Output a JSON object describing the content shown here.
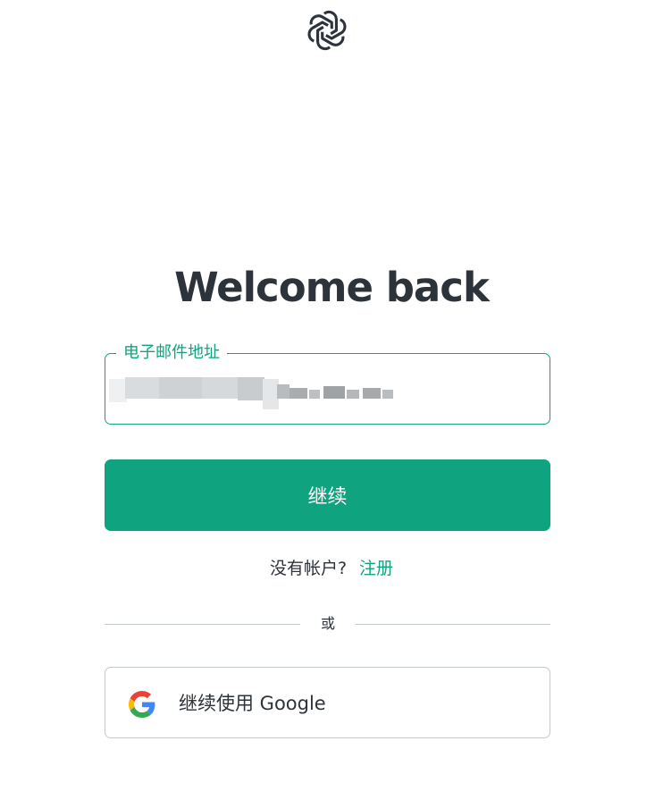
{
  "header": {
    "logo_icon": "openai-logo-icon"
  },
  "title": "Welcome back",
  "email": {
    "label": "电子邮件地址",
    "value": "",
    "value_obscured": true
  },
  "continue_button": {
    "label": "继续"
  },
  "signup": {
    "question": "没有帐户?",
    "link_label": "注册"
  },
  "divider": {
    "label": "或"
  },
  "google_button": {
    "icon": "google-icon",
    "label": "继续使用 Google"
  },
  "colors": {
    "accent": "#10a37f",
    "text": "#2d333a",
    "border": "#c2c8d0",
    "background": "#ffffff"
  }
}
